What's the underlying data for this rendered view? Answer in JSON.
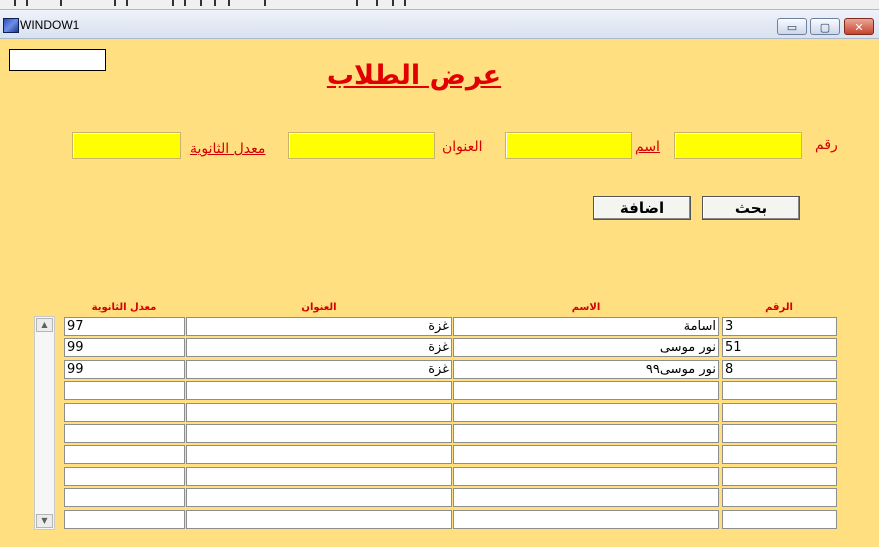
{
  "window": {
    "title": "WINDOW1",
    "minimize_glyph": "▭",
    "maximize_glyph": "▢",
    "close_glyph": "✕"
  },
  "page_title": "عرض الطلاب",
  "form": {
    "number_label": "رقم",
    "number_value": "",
    "name_label": "اسم",
    "name_value": "",
    "address_label": "العنوان",
    "address_value": "",
    "gpa_label": "معدل الثانوية",
    "gpa_value": "",
    "top_left_value": ""
  },
  "buttons": {
    "search": "بحث",
    "add": "اضافة"
  },
  "table": {
    "headers": {
      "number": "الرقم",
      "name": "الاسم",
      "address": "العنوان",
      "gpa": "معدل الثانوية"
    },
    "rows": [
      {
        "number": "3",
        "name": "اسامة",
        "address": "غزة",
        "gpa": "97"
      },
      {
        "number": "51",
        "name": "نور موسى",
        "address": "غزة",
        "gpa": "99"
      },
      {
        "number": "8",
        "name": "نور موسى٩٩",
        "address": "غزة",
        "gpa": "99"
      },
      {
        "number": "",
        "name": "",
        "address": "",
        "gpa": ""
      },
      {
        "number": "",
        "name": "",
        "address": "",
        "gpa": ""
      },
      {
        "number": "",
        "name": "",
        "address": "",
        "gpa": ""
      },
      {
        "number": "",
        "name": "",
        "address": "",
        "gpa": ""
      },
      {
        "number": "",
        "name": "",
        "address": "",
        "gpa": ""
      },
      {
        "number": "",
        "name": "",
        "address": "",
        "gpa": ""
      },
      {
        "number": "",
        "name": "",
        "address": "",
        "gpa": ""
      }
    ]
  },
  "scrollbar": {
    "up_glyph": "▲",
    "down_glyph": "▼"
  },
  "colors": {
    "window_bg": "#ffdf80",
    "input_bg": "#ffff00",
    "label_red": "#d40000",
    "title_red": "#e00000"
  }
}
